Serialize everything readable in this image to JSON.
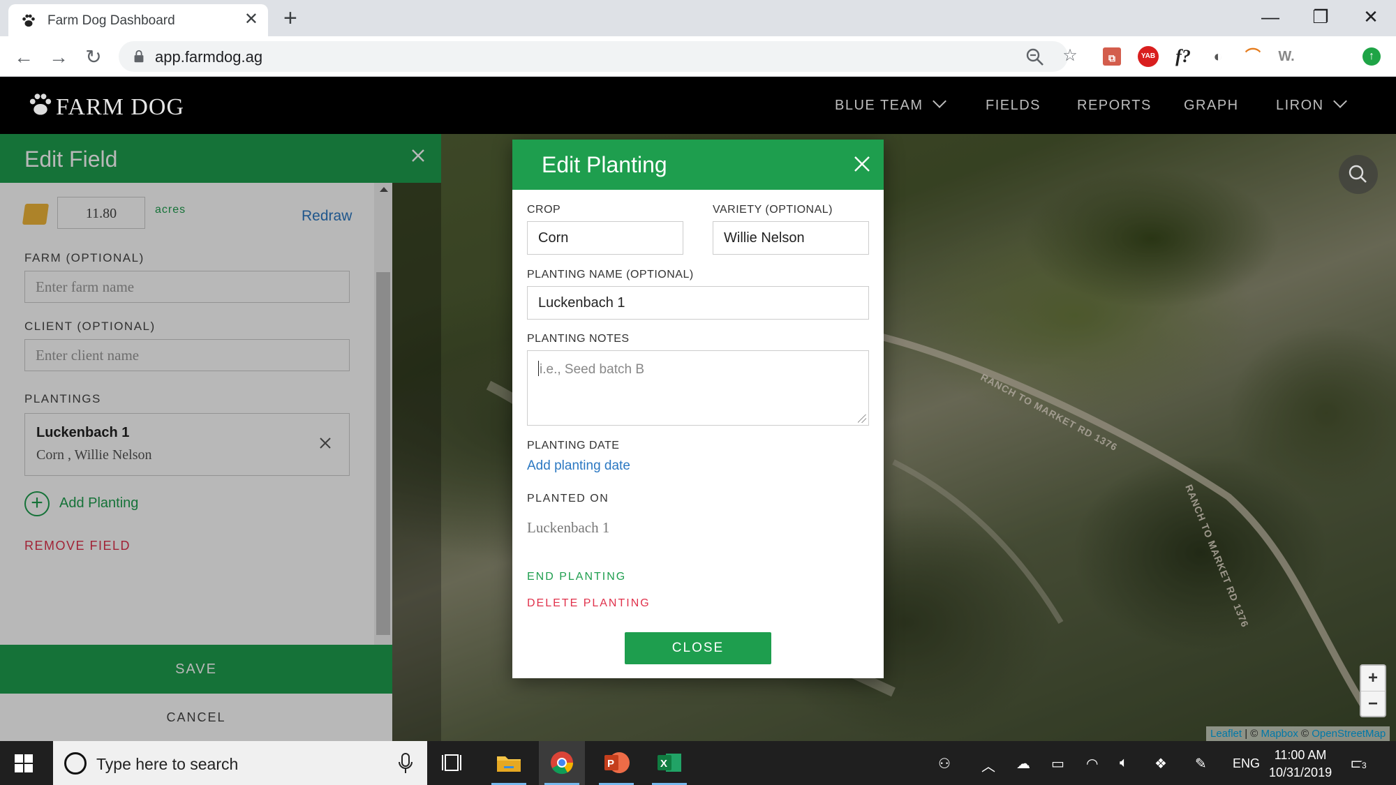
{
  "browser": {
    "tab_title": "Farm Dog Dashboard",
    "tab_close": "✕",
    "new_tab": "+",
    "url": "app.farmdog.ag",
    "window_controls": {
      "minimize": "—",
      "restore": "❐",
      "close": "✕"
    },
    "extensions": [
      "YAB",
      "f?",
      "W."
    ]
  },
  "app": {
    "brand": "FARM DOG",
    "nav": {
      "team": "BLUE TEAM",
      "fields": "FIELDS",
      "reports": "REPORTS",
      "graph": "GRAPH",
      "user": "LIRON"
    }
  },
  "edit_field": {
    "title": "Edit Field",
    "acres_value": "11.80",
    "acres_label": "acres",
    "redraw": "Redraw",
    "farm_label": "FARM (OPTIONAL)",
    "farm_placeholder": "Enter farm name",
    "client_label": "CLIENT (OPTIONAL)",
    "client_placeholder": "Enter client name",
    "plantings_label": "PLANTINGS",
    "plantings": [
      {
        "name": "Luckenbach 1",
        "details": "Corn , Willie Nelson"
      }
    ],
    "add_planting": "Add Planting",
    "remove_field": "REMOVE FIELD",
    "save": "SAVE",
    "cancel": "CANCEL"
  },
  "edit_planting": {
    "title": "Edit Planting",
    "crop_label": "CROP",
    "crop_value": "Corn",
    "variety_label": "VARIETY (OPTIONAL)",
    "variety_value": "Willie Nelson",
    "name_label": "PLANTING NAME (OPTIONAL)",
    "name_value": "Luckenbach 1",
    "notes_label": "PLANTING NOTES",
    "notes_placeholder": "i.e., Seed batch B",
    "date_label": "PLANTING DATE",
    "add_date": "Add planting date",
    "planted_on_label": "PLANTED ON",
    "planted_on_value": "Luckenbach 1",
    "end_planting": "END PLANTING",
    "delete_planting": "DELETE PLANTING",
    "close": "CLOSE"
  },
  "map": {
    "road_1": "RANCH TO MARKET RD 1376",
    "road_2": "RANCH TO MARKET RD 1376",
    "zoom_in": "+",
    "zoom_out": "−",
    "attribution_leaflet": "Leaflet",
    "attribution_sep": " | © ",
    "attribution_mapbox": "Mapbox",
    "attribution_sep2": " © ",
    "attribution_osm": "OpenStreetMap"
  },
  "taskbar": {
    "search_placeholder": "Type here to search",
    "language": "ENG",
    "time": "11:00 AM",
    "date": "10/31/2019",
    "notification_count": "3"
  },
  "colors": {
    "accent_green": "#1e9e4e",
    "danger_red": "#e0314b",
    "link_blue": "#2b78c2"
  }
}
